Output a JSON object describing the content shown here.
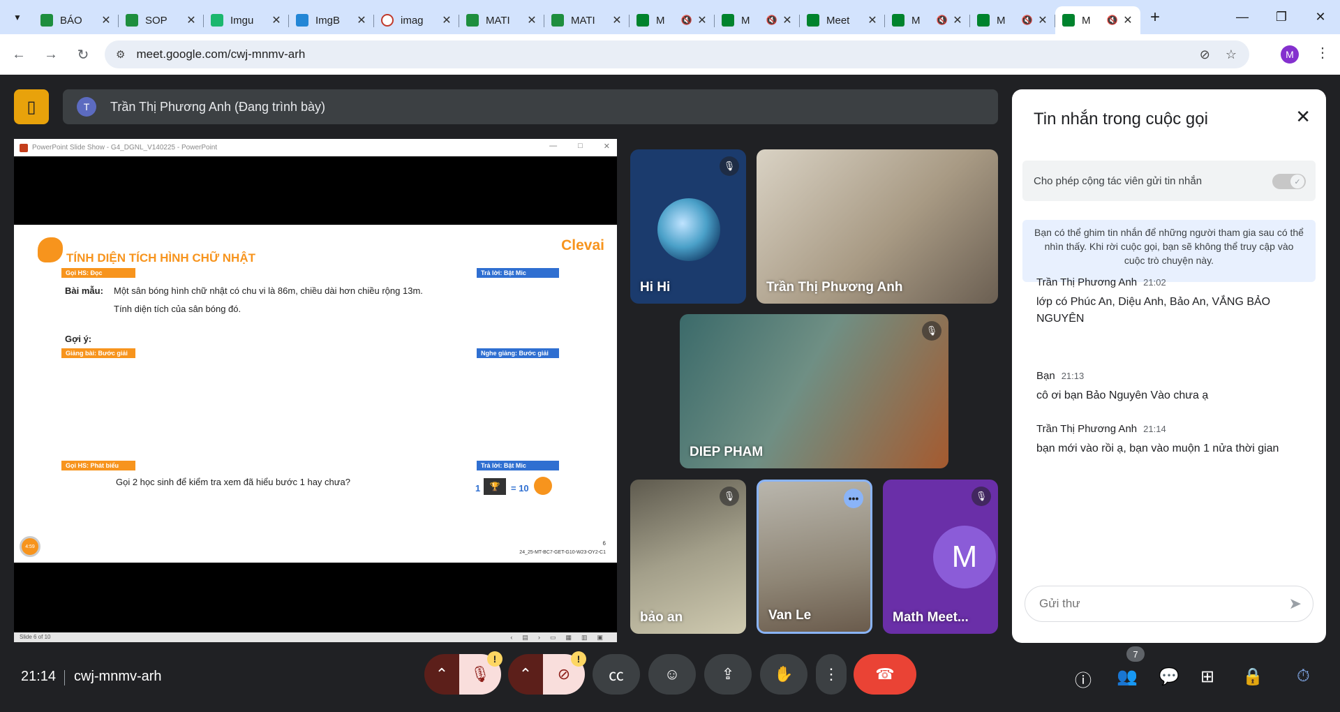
{
  "browser": {
    "tabs": [
      {
        "title": "BÁO",
        "icon": "sheets-icon",
        "color": "#1e8e3e"
      },
      {
        "title": "SOP",
        "icon": "sheets-icon",
        "color": "#1e8e3e"
      },
      {
        "title": "Imgu",
        "icon": "imgur-icon",
        "color": "#1bb76e"
      },
      {
        "title": "ImgB",
        "icon": "imgbb-icon",
        "color": "#2386d6"
      },
      {
        "title": "imag",
        "icon": "image-icon",
        "color": "#c0392b"
      },
      {
        "title": "MATI",
        "icon": "sheets-icon",
        "color": "#1e8e3e"
      },
      {
        "title": "MATI",
        "icon": "sheets-icon",
        "color": "#1e8e3e"
      },
      {
        "title": "M",
        "icon": "meet-icon",
        "color": "#00832d",
        "muted": true
      },
      {
        "title": "M",
        "icon": "meet-icon",
        "color": "#00832d",
        "muted": true
      },
      {
        "title": "Meet",
        "icon": "meet-icon",
        "color": "#00832d"
      },
      {
        "title": "M",
        "icon": "meet-icon",
        "color": "#00832d",
        "muted": true
      },
      {
        "title": "M",
        "icon": "meet-icon",
        "color": "#00832d",
        "muted": true
      },
      {
        "title": "M",
        "icon": "meet-icon",
        "color": "#00832d",
        "muted": true,
        "active": true
      }
    ],
    "url": "meet.google.com/cwj-mnmv-arh",
    "profile_initial": "M"
  },
  "meeting": {
    "presenter_initial": "T",
    "presenter_label": "Trần Thị Phương Anh (Đang trình bày)",
    "time": "21:14",
    "code": "cwj-mnmv-arh",
    "participant_count": "7"
  },
  "presentation": {
    "window_title": "PowerPoint Slide Show  -  G4_DGNL_V140225 - PowerPoint",
    "status": "Slide 6 of 10",
    "slide": {
      "title": "TÍNH DIỆN TÍCH HÌNH CHỮ NHẬT",
      "logo": "Clevai",
      "tag_goi_doc": "Gọi HS: Đọc",
      "tag_tra_loi_1": "Trả lời: Bật Mic",
      "bai_mau_label": "Bài mẫu:",
      "bai_mau_line1": "Một sân bóng hình chữ nhật có chu vi là 86m, chiều dài hơn chiều rộng 13m.",
      "bai_mau_line2": "Tính diện tích của sân bóng đó.",
      "goi_y": "Gợi ý:",
      "tag_giang_bai": "Giảng bài: Bước giải",
      "tag_nghe_giang": "Nghe giảng: Bước giải",
      "tag_goi_phat_bieu": "Gọi HS: Phát biểu",
      "tag_tra_loi_2": "Trả lời: Bật Mic",
      "question": "Gọi 2 học sinh để kiểm tra xem đã hiểu bước 1 hay chưa?",
      "reward_count": "1",
      "reward_value": "= 10",
      "timer": "4:59",
      "page_number": "6",
      "code": "24_25-MT-BC7-GET-G10-W23-OY2-C1"
    }
  },
  "participants": [
    {
      "name": "Hi Hi",
      "muted": true
    },
    {
      "name": "Trần Thị Phương Anh",
      "muted": false
    },
    {
      "name": "DIEP PHAM",
      "muted": true
    },
    {
      "name": "bảo an",
      "muted": true
    },
    {
      "name": "Van Le",
      "muted": false
    },
    {
      "name": "Math Meet...",
      "muted": true,
      "initial": "M"
    }
  ],
  "chat": {
    "title": "Tin nhắn trong cuộc gọi",
    "allow_label": "Cho phép cộng tác viên gửi tin nhắn",
    "info": "Bạn có thể ghim tin nhắn để những người tham gia sau có thể nhìn thấy. Khi rời cuộc gọi, bạn sẽ không thể truy cập vào cuộc trò chuyện này.",
    "messages": [
      {
        "sender": "Trần Thị Phương Anh",
        "time": "21:02",
        "text": "lớp có Phúc An, Diệu Anh, Bảo An, VẮNG BẢO NGUYÊN"
      },
      {
        "sender": "Bạn",
        "time": "21:13",
        "text": "cô ơi bạn Bảo Nguyên Vào chưa ạ"
      },
      {
        "sender": "Trần Thị Phương Anh",
        "time": "21:14",
        "text": "bạn mới vào rồi ạ, bạn vào muộn 1 nửa thời gian"
      }
    ],
    "input_placeholder": "Gửi thư"
  },
  "colors": {
    "accent": "#e8a20b",
    "leave": "#ea4335",
    "mic_off_bg": "#f9dedc",
    "chat_icon": "#8ab4f8"
  }
}
